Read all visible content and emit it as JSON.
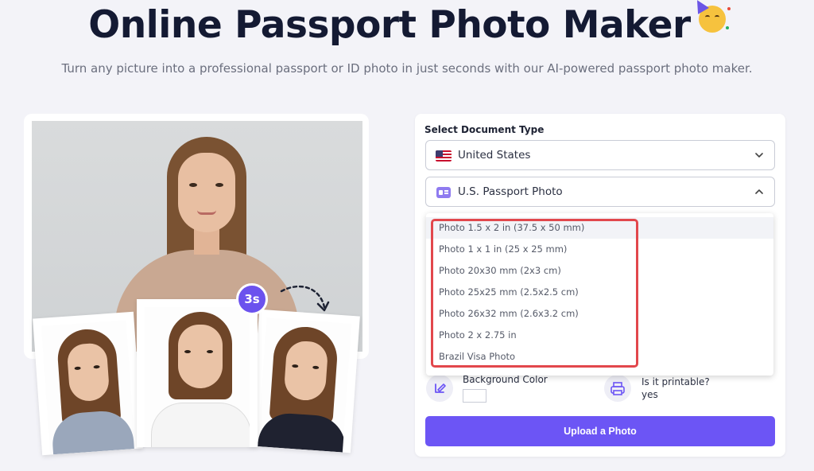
{
  "header": {
    "title": "Online Passport Photo Maker",
    "emoji": "partying-face-emoji",
    "subtitle": "Turn any picture into a professional passport or ID photo in just seconds with our AI-powered passport photo maker."
  },
  "hero": {
    "timer_label": "3s"
  },
  "form": {
    "section_label": "Select Document Type",
    "country": {
      "value": "United States",
      "icon": "us-flag-icon"
    },
    "document": {
      "value": "U.S. Passport Photo",
      "icon": "id-card-icon"
    },
    "size_options": [
      "Photo 1.5 x 2 in (37.5 x 50 mm)",
      "Photo 1 x 1 in (25 x 25 mm)",
      "Photo 20x30 mm (2x3 cm)",
      "Photo 25x25 mm (2.5x2.5 cm)",
      "Photo 26x32 mm (2.6x3.2 cm)",
      "Photo 2 x 2.75 in",
      "Brazil Visa Photo"
    ],
    "features": {
      "background": {
        "title": "Background Color",
        "icon": "paint-brush-icon"
      },
      "printable": {
        "title": "Is it printable?",
        "value": "yes",
        "icon": "printer-icon"
      }
    },
    "upload_label": "Upload a Photo"
  },
  "colors": {
    "accent": "#6c55f5",
    "highlight": "#e2474c"
  }
}
